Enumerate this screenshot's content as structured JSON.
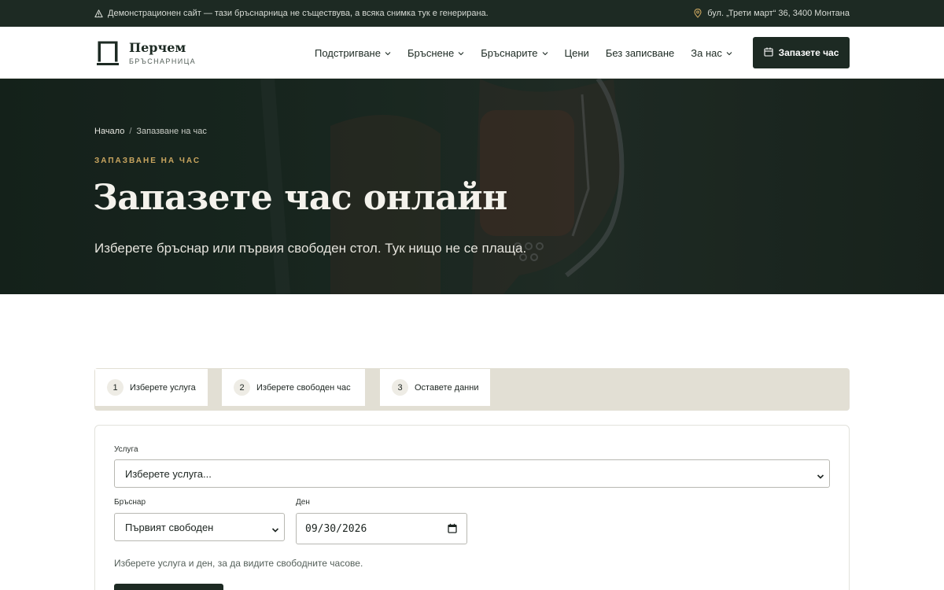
{
  "topbar": {
    "notice": "Демонстрационен сайт — тази бръснарница не съществува, а всяка снимка тук е генерирана.",
    "address": "бул. „Трети март“ 36, 3400 Монтана"
  },
  "brand": {
    "name": "Перчем",
    "tagline": "БРЪСНАРНИЦА"
  },
  "nav": {
    "items": [
      {
        "label": "Подстригване",
        "has_dropdown": true
      },
      {
        "label": "Бръснене",
        "has_dropdown": true
      },
      {
        "label": "Бръснарите",
        "has_dropdown": true
      },
      {
        "label": "Цени",
        "has_dropdown": false
      },
      {
        "label": "Без записване",
        "has_dropdown": false
      },
      {
        "label": "За нас",
        "has_dropdown": true
      }
    ],
    "cta_label": "Запазете час"
  },
  "hero": {
    "breadcrumb": {
      "home": "Начало",
      "separator": "/",
      "current": "Запазване на час"
    },
    "eyebrow": "ЗАПАЗВАНЕ НА ЧАС",
    "title": "Запазете час онлайн",
    "lead": "Изберете бръснар или първия свободен стол. Тук нищо не се плаща."
  },
  "steps": [
    {
      "number": "1",
      "label": "Изберете услуга"
    },
    {
      "number": "2",
      "label": "Изберете свободен час"
    },
    {
      "number": "3",
      "label": "Оставете данни"
    }
  ],
  "form": {
    "service": {
      "label": "Услуга",
      "value": "Изберете услуга..."
    },
    "barber": {
      "label": "Бръснар",
      "value": "Първият свободен"
    },
    "day": {
      "label": "Ден",
      "value": "09/30/2026"
    },
    "hint": "Изберете услуга и ден, за да видите свободните часове."
  },
  "colors": {
    "primary": "#1d2a23",
    "accent": "#c9a55f",
    "steps_background": "#e2dfd4"
  }
}
